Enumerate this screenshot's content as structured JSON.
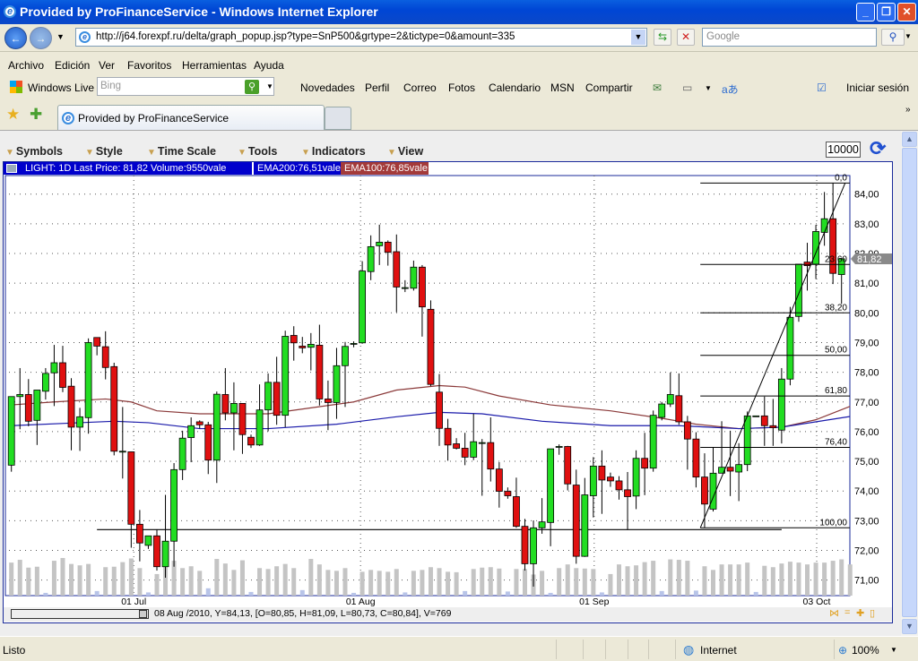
{
  "window": {
    "title": "Provided by ProFinanceService - Windows Internet Explorer"
  },
  "address": {
    "url": "http://j64.forexpf.ru/delta/graph_popup.jsp?type=SnP500&grtype=2&tictype=0&amount=335",
    "search_placeholder": "Google"
  },
  "menu": [
    "Archivo",
    "Edición",
    "Ver",
    "Favoritos",
    "Herramientas",
    "Ayuda"
  ],
  "links": {
    "windows_live": "Windows Live",
    "bing_placeholder": "Bing",
    "items": [
      "Novedades",
      "Perfil",
      "Correo",
      "Fotos",
      "Calendario",
      "MSN",
      "Compartir"
    ],
    "signin": "Iniciar sesión"
  },
  "tab": {
    "title": "Provided by ProFinanceService"
  },
  "applet": {
    "menu": [
      "Symbols",
      "Style",
      "Time Scale",
      "Tools",
      "Indicators",
      "View"
    ],
    "amount": "10000",
    "info": {
      "main": "LIGHT: 1D Last Price: 81,82 Volume:9550vale",
      "ema200": "EMA200:76,51vale",
      "ema100": "EMA100:76,85vale"
    },
    "crosshair_readout": "08 Aug /2010, Y=84,13, [O=80,85, H=81,09, L=80,73, C=80,84], V=769",
    "colors": {
      "up": "#22dd22",
      "down": "#e01010",
      "ema100": "#8b3a3a",
      "ema200": "#1a1aaa",
      "info_bg": "#0000cc",
      "ema100_bg": "#a33a3a",
      "volume": "#c4c4c4",
      "last_price_bg": "#8a8a8a"
    }
  },
  "chart_data": {
    "type": "candlestick",
    "symbol": "LIGHT",
    "interval": "1D",
    "last_price": "81,82",
    "last_price_value": 81.82,
    "ylim": [
      70.5,
      84.6
    ],
    "yticks": [
      "71,00",
      "72,00",
      "73,00",
      "74,00",
      "75,00",
      "76,00",
      "77,00",
      "78,00",
      "79,00",
      "80,00",
      "81,00",
      "82,00",
      "83,00",
      "84,00"
    ],
    "xlabels": [
      {
        "label": "01 Jul",
        "index": 14.3
      },
      {
        "label": "01 Aug",
        "index": 40.8
      },
      {
        "label": "01 Sep",
        "index": 68.1
      },
      {
        "label": "03 Oct",
        "index": 94.1
      }
    ],
    "ohlc": [
      [
        74.87,
        77.18,
        74.65,
        77.18
      ],
      [
        77.18,
        78.14,
        76.08,
        77.25
      ],
      [
        77.25,
        77.77,
        76.18,
        76.35
      ],
      [
        76.38,
        77.4,
        75.55,
        77.4
      ],
      [
        77.36,
        78.14,
        77.08,
        77.96
      ],
      [
        77.98,
        78.92,
        76.86,
        78.32
      ],
      [
        78.32,
        78.89,
        77.33,
        77.49
      ],
      [
        77.53,
        77.8,
        75.37,
        76.15
      ],
      [
        76.15,
        76.8,
        75.35,
        76.5
      ],
      [
        76.47,
        79.14,
        75.93,
        79.0
      ],
      [
        79.17,
        79.17,
        78.57,
        78.88
      ],
      [
        78.86,
        79.38,
        77.76,
        78.16
      ],
      [
        78.19,
        78.32,
        75.2,
        75.34
      ],
      [
        75.34,
        76.83,
        74.42,
        75.34
      ],
      [
        75.32,
        75.32,
        72.09,
        72.88
      ],
      [
        72.88,
        73.36,
        71.63,
        72.25
      ],
      [
        72.17,
        72.49,
        72.05,
        72.49
      ],
      [
        72.49,
        72.71,
        71.32,
        71.45
      ],
      [
        71.45,
        73.87,
        71.08,
        72.31
      ],
      [
        72.31,
        74.94,
        71.45,
        74.72
      ],
      [
        74.72,
        76.03,
        74.37,
        75.78
      ],
      [
        75.8,
        76.48,
        74.97,
        76.2
      ],
      [
        76.33,
        76.38,
        76.11,
        76.23
      ],
      [
        76.23,
        76.33,
        74.57,
        75.04
      ],
      [
        75.04,
        77.35,
        74.27,
        77.26
      ],
      [
        77.25,
        78.14,
        76.38,
        76.63
      ],
      [
        76.63,
        77.66,
        75.37,
        76.95
      ],
      [
        76.95,
        76.95,
        75.25,
        75.9
      ],
      [
        75.81,
        75.9,
        75.45,
        75.55
      ],
      [
        75.55,
        77.59,
        75.52,
        76.73
      ],
      [
        76.73,
        77.96,
        76.01,
        77.66
      ],
      [
        77.66,
        78.52,
        76.23,
        76.55
      ],
      [
        76.55,
        79.4,
        76.15,
        79.21
      ],
      [
        79.24,
        79.55,
        78.39,
        78.99
      ],
      [
        78.88,
        79.19,
        78.64,
        78.82
      ],
      [
        78.84,
        79.32,
        78.06,
        78.94
      ],
      [
        78.91,
        79.6,
        76.88,
        77.1
      ],
      [
        77.1,
        77.72,
        76.05,
        76.98
      ],
      [
        76.98,
        78.82,
        76.43,
        78.22
      ],
      [
        78.22,
        79.02,
        76.83,
        78.87
      ],
      [
        78.97,
        79.04,
        78.84,
        78.97
      ],
      [
        78.99,
        81.74,
        78.96,
        81.41
      ],
      [
        81.39,
        82.61,
        81.1,
        82.23
      ],
      [
        82.26,
        82.97,
        81.61,
        82.38
      ],
      [
        82.38,
        82.44,
        81.59,
        82.04
      ],
      [
        82.06,
        82.64,
        80.02,
        80.87
      ],
      [
        80.85,
        81.1,
        80.7,
        80.85
      ],
      [
        80.83,
        81.76,
        80.75,
        81.54
      ],
      [
        81.54,
        81.61,
        79.2,
        80.2
      ],
      [
        80.12,
        80.42,
        77.53,
        77.59
      ],
      [
        77.33,
        77.94,
        75.52,
        76.11
      ],
      [
        76.11,
        76.43,
        75.02,
        75.55
      ],
      [
        75.59,
        75.78,
        75.4,
        75.44
      ],
      [
        75.44,
        75.96,
        74.87,
        75.14
      ],
      [
        75.14,
        76.6,
        75.04,
        75.66
      ],
      [
        75.63,
        75.75,
        73.84,
        75.63
      ],
      [
        75.63,
        76.48,
        74.32,
        74.74
      ],
      [
        74.74,
        74.97,
        73.44,
        73.99
      ],
      [
        73.99,
        74.12,
        73.74,
        73.84
      ],
      [
        73.81,
        74.45,
        72.76,
        72.81
      ],
      [
        72.81,
        73.06,
        71.32,
        71.55
      ],
      [
        71.55,
        73.01,
        70.78,
        72.76
      ],
      [
        72.76,
        73.76,
        72.56,
        72.96
      ],
      [
        72.94,
        75.42,
        72.14,
        75.42
      ],
      [
        75.5,
        75.57,
        75.22,
        75.5
      ],
      [
        75.5,
        75.52,
        74.02,
        74.24
      ],
      [
        74.2,
        74.72,
        71.55,
        71.8
      ],
      [
        71.8,
        74.44,
        71.78,
        73.87
      ],
      [
        73.84,
        75.14,
        73.11,
        74.84
      ],
      [
        74.84,
        75.37,
        73.23,
        74.37
      ],
      [
        74.47,
        74.62,
        74.14,
        74.34
      ],
      [
        74.34,
        74.5,
        73.71,
        74.04
      ],
      [
        74.04,
        74.64,
        72.69,
        73.81
      ],
      [
        73.83,
        75.37,
        73.39,
        75.1
      ],
      [
        75.1,
        75.96,
        73.86,
        74.77
      ],
      [
        74.77,
        76.71,
        74.65,
        76.55
      ],
      [
        76.48,
        77.0,
        76.38,
        76.93
      ],
      [
        76.93,
        77.99,
        76.83,
        77.25
      ],
      [
        77.21,
        77.96,
        76.23,
        76.33
      ],
      [
        76.33,
        76.53,
        74.72,
        75.75
      ],
      [
        75.75,
        75.98,
        74.12,
        74.47
      ],
      [
        74.47,
        75.27,
        72.76,
        73.56
      ],
      [
        73.39,
        75.47,
        73.31,
        74.6
      ],
      [
        74.6,
        76.35,
        74.6,
        74.8
      ],
      [
        74.8,
        76.03,
        73.83,
        74.67
      ],
      [
        74.64,
        75.61,
        73.66,
        74.89
      ],
      [
        74.89,
        76.68,
        74.67,
        76.53
      ],
      [
        76.53,
        76.53,
        76.53,
        76.53
      ],
      [
        76.53,
        77.18,
        75.52,
        76.2
      ],
      [
        76.2,
        77.1,
        75.52,
        76.13
      ],
      [
        76.05,
        78.14,
        75.6,
        77.77
      ],
      [
        77.77,
        80.2,
        77.56,
        79.85
      ],
      [
        79.88,
        81.64,
        79.7,
        81.64
      ],
      [
        81.71,
        82.36,
        80.75,
        81.59
      ],
      [
        81.64,
        82.96,
        81.14,
        82.74
      ],
      [
        82.71,
        84.07,
        82.26,
        83.17
      ],
      [
        83.17,
        84.37,
        80.97,
        81.33
      ],
      [
        81.29,
        81.86,
        80.3,
        81.82
      ]
    ],
    "volume": [
      720,
      780,
      610,
      630,
      60,
      760,
      820,
      690,
      660,
      690,
      100,
      620,
      630,
      730,
      810,
      600,
      70,
      470,
      780,
      760,
      600,
      640,
      540,
      160,
      800,
      700,
      560,
      770,
      80,
      600,
      580,
      640,
      690,
      600,
      120,
      800,
      680,
      560,
      540,
      600,
      60,
      520,
      560,
      540,
      520,
      580,
      70,
      540,
      560,
      620,
      600,
      520,
      510,
      100,
      580,
      610,
      620,
      590,
      90,
      580,
      580,
      460,
      540,
      60,
      600,
      680,
      600,
      590,
      580,
      70,
      470,
      680,
      640,
      660,
      730,
      760,
      100,
      790,
      780,
      760,
      110,
      640,
      560,
      680,
      680,
      680,
      720,
      80,
      650,
      620,
      700,
      740,
      720,
      680,
      720,
      720,
      760,
      790,
      680
    ],
    "ema100": [
      [
        0,
        76.9
      ],
      [
        5,
        77.0
      ],
      [
        11,
        77.1
      ],
      [
        14,
        77.0
      ],
      [
        17,
        76.7
      ],
      [
        22,
        76.6
      ],
      [
        30,
        76.6
      ],
      [
        35,
        76.8
      ],
      [
        40,
        77.0
      ],
      [
        45,
        77.4
      ],
      [
        50,
        77.55
      ],
      [
        53,
        77.5
      ],
      [
        57,
        77.2
      ],
      [
        63,
        76.9
      ],
      [
        70,
        76.7
      ],
      [
        76,
        76.45
      ],
      [
        80,
        76.25
      ],
      [
        85,
        76.1
      ],
      [
        90,
        76.15
      ],
      [
        94,
        76.4
      ],
      [
        98,
        76.85
      ]
    ],
    "ema200": [
      [
        0,
        76.2
      ],
      [
        8,
        76.3
      ],
      [
        12,
        76.35
      ],
      [
        16,
        76.3
      ],
      [
        22,
        76.1
      ],
      [
        30,
        76.1
      ],
      [
        38,
        76.25
      ],
      [
        45,
        76.5
      ],
      [
        50,
        76.65
      ],
      [
        55,
        76.6
      ],
      [
        62,
        76.35
      ],
      [
        70,
        76.2
      ],
      [
        78,
        76.2
      ],
      [
        85,
        76.1
      ],
      [
        90,
        76.15
      ],
      [
        98,
        76.51
      ]
    ],
    "fibonacci": {
      "low": 72.76,
      "high": 84.37,
      "levels": [
        {
          "label": "0,0",
          "value": 84.37
        },
        {
          "label": "23,60",
          "value": 81.63
        },
        {
          "label": "38,20",
          "value": 80.0
        },
        {
          "label": "50,00",
          "value": 78.57
        },
        {
          "label": "61,80",
          "value": 77.2
        },
        {
          "label": "76,40",
          "value": 75.47
        },
        {
          "label": "100,00",
          "value": 72.76
        }
      ],
      "start_index": 80.5
    },
    "support_line": {
      "value": 72.7,
      "from_index": 10,
      "to_index": 90
    }
  },
  "status": {
    "text": "Listo",
    "zone": "Internet",
    "zoom": "100%"
  }
}
